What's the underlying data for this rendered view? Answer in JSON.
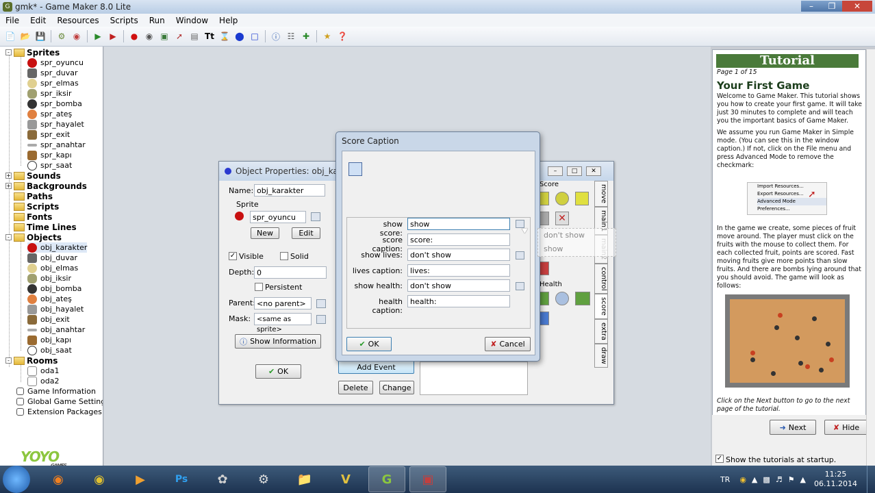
{
  "window": {
    "title": "gmk* - Game Maker 8.0 Lite",
    "app_icon": "game-maker-icon"
  },
  "menu": [
    "File",
    "Edit",
    "Resources",
    "Scripts",
    "Run",
    "Window",
    "Help"
  ],
  "tree": {
    "groups": [
      {
        "label": "Sprites",
        "items": [
          "spr_oyuncu",
          "spr_duvar",
          "spr_elmas",
          "spr_iksir",
          "spr_bomba",
          "spr_ateş",
          "spr_hayalet",
          "spr_exit",
          "spr_anahtar",
          "spr_kapı",
          "spr_saat"
        ]
      },
      {
        "label": "Sounds"
      },
      {
        "label": "Backgrounds"
      },
      {
        "label": "Paths"
      },
      {
        "label": "Scripts"
      },
      {
        "label": "Fonts"
      },
      {
        "label": "Time Lines"
      },
      {
        "label": "Objects",
        "items": [
          "obj_karakter",
          "obj_duvar",
          "obj_elmas",
          "obj_iksir",
          "obj_bomba",
          "obj_ateş",
          "obj_hayalet",
          "obj_exit",
          "obj_anahtar",
          "obj_kapı",
          "obj_saat"
        ]
      },
      {
        "label": "Rooms",
        "items": [
          "oda1",
          "oda2"
        ]
      }
    ],
    "extras": [
      "Game Information",
      "Global Game Settings",
      "Extension Packages"
    ]
  },
  "logo": {
    "text": "YOYO",
    "sub": "GAMES"
  },
  "object_props": {
    "title": "Object Properties: obj_karakt",
    "name_label": "Name:",
    "name_value": "obj_karakter",
    "sprite_label": "Sprite",
    "sprite_value": "spr_oyuncu",
    "new_btn": "New",
    "edit_btn": "Edit",
    "visible_label": "Visible",
    "solid_label": "Solid",
    "depth_label": "Depth:",
    "depth_value": "0",
    "persistent_label": "Persistent",
    "parent_label": "Parent:",
    "parent_value": "<no parent>",
    "mask_label": "Mask:",
    "mask_value": "<same as sprite>",
    "show_info_btn": "Show Information",
    "ok_btn": "OK",
    "add_event_btn": "Add Event",
    "delete_btn": "Delete",
    "change_btn": "Change",
    "score_label": "Score",
    "health_label": "Health",
    "tabs": [
      "move",
      "main1",
      "main2",
      "control",
      "score",
      "extra",
      "draw"
    ]
  },
  "score_dialog": {
    "title": "Score Caption",
    "rows": [
      {
        "label": "show score:",
        "value": "show"
      },
      {
        "label": "score caption:",
        "value": "score:"
      },
      {
        "label": "show lives:",
        "value": "don't show"
      },
      {
        "label": "lives caption:",
        "value": "lives:"
      },
      {
        "label": "show health:",
        "value": "don't show"
      },
      {
        "label": "health caption:",
        "value": "health:"
      }
    ],
    "ok_btn": "OK",
    "cancel_btn": "Cancel"
  },
  "dropdown_popup": {
    "options": [
      "don't show",
      "show"
    ]
  },
  "tutorial": {
    "header": "Tutorial",
    "page": "Page 1 of 15",
    "heading": "Your First Game",
    "p1": "Welcome to Game Maker. This tutorial shows you how to create your first game. It will take just 30 minutes to complete and will teach you the important basics of Game Maker.",
    "p2": "We assume you run Game Maker in Simple mode. (You can see this in the window caption.) If not, click on the File menu and press Advanced Mode to remove the checkmark:",
    "menu_shot": [
      "Import Resources...",
      "Export Resources...",
      "Advanced Mode",
      "Preferences..."
    ],
    "p3": "In the game we create, some pieces of fruit move around. The player must click on the fruits with the mouse to collect them. For each collected fruit, points are scored. Fast moving fruits give more points than slow fruits. And there are bombs lying around that you should avoid. The game will look as follows:",
    "p4": "Click on the Next button to go to the next page of the tutorial.",
    "next_btn": "Next",
    "hide_btn": "Hide",
    "startup_label": "Show the tutorials at startup."
  },
  "taskbar": {
    "lang": "TR",
    "time": "11:25",
    "date": "06.11.2014"
  }
}
